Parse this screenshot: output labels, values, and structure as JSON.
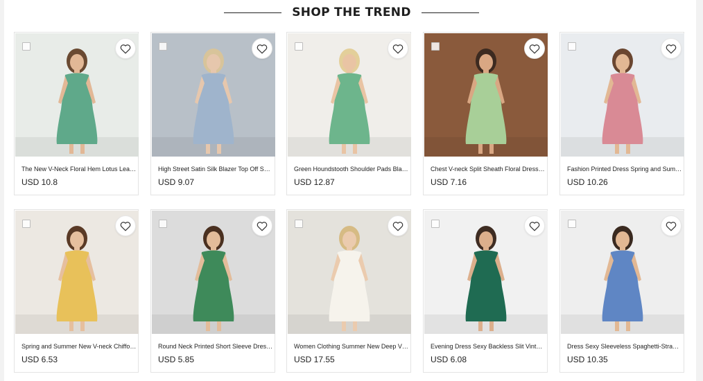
{
  "section": {
    "title": "SHOP THE TREND"
  },
  "products": [
    {
      "name": "The New V-Neck Floral Hem Lotus Leaf Sleeve Dress",
      "price": "USD 10.8",
      "bg": "#e8ece8",
      "fg": "#5fa98a",
      "skin": "#e2b896",
      "hair": "#6a4a32"
    },
    {
      "name": "High Street Satin Silk Blazer Top Off Shoulder Set",
      "price": "USD 9.07",
      "bg": "#b8c0c8",
      "fg": "#9fb4cc",
      "skin": "#e6c7ad",
      "hair": "#d8c49a"
    },
    {
      "name": "Green Houndstooth Shoulder Pads Blazer Shorts Set",
      "price": "USD 12.87",
      "bg": "#f0eeea",
      "fg": "#6db58c",
      "skin": "#e9c4a4",
      "hair": "#e3cf9a"
    },
    {
      "name": "Chest V-neck Split Sheath Floral Dress Summer",
      "price": "USD 7.16",
      "bg": "#8a5a3c",
      "fg": "#a8cf98",
      "skin": "#d9a783",
      "hair": "#3c2a20"
    },
    {
      "name": "Fashion Printed Dress Spring and Summer New Halter",
      "price": "USD 10.26",
      "bg": "#e9ecef",
      "fg": "#d98a95",
      "skin": "#e2b894",
      "hair": "#6a4630"
    },
    {
      "name": "Spring and Summer New V-neck Chiffon Floral Dress",
      "price": "USD 6.53",
      "bg": "#ece8e2",
      "fg": "#e8c15a",
      "skin": "#e6bf9e",
      "hair": "#5a3a26"
    },
    {
      "name": "Round Neck Printed Short Sleeve Dress Long Skirt",
      "price": "USD 5.85",
      "bg": "#dcdcdc",
      "fg": "#3e8a5a",
      "skin": "#e3bc9a",
      "hair": "#4a3020"
    },
    {
      "name": "Women Clothing Summer New Deep V Lace Maxi Dress",
      "price": "USD 17.55",
      "bg": "#e4e2dc",
      "fg": "#f6f3ec",
      "skin": "#ebcbae",
      "hair": "#d6bb84"
    },
    {
      "name": "Evening Dress Sexy Backless Slit Vintage Satin Dress",
      "price": "USD 6.08",
      "bg": "#f1f1f1",
      "fg": "#1f6b52",
      "skin": "#dcaf8c",
      "hair": "#3e2c22"
    },
    {
      "name": "Dress Sexy Sleeveless Spaghetti-Strap Floral Maxi",
      "price": "USD 10.35",
      "bg": "#eeeeee",
      "fg": "#5f86c4",
      "skin": "#e2b894",
      "hair": "#3a2a20"
    }
  ],
  "icons": {
    "wishlist": "heart-outline-icon",
    "select": "checkbox"
  }
}
